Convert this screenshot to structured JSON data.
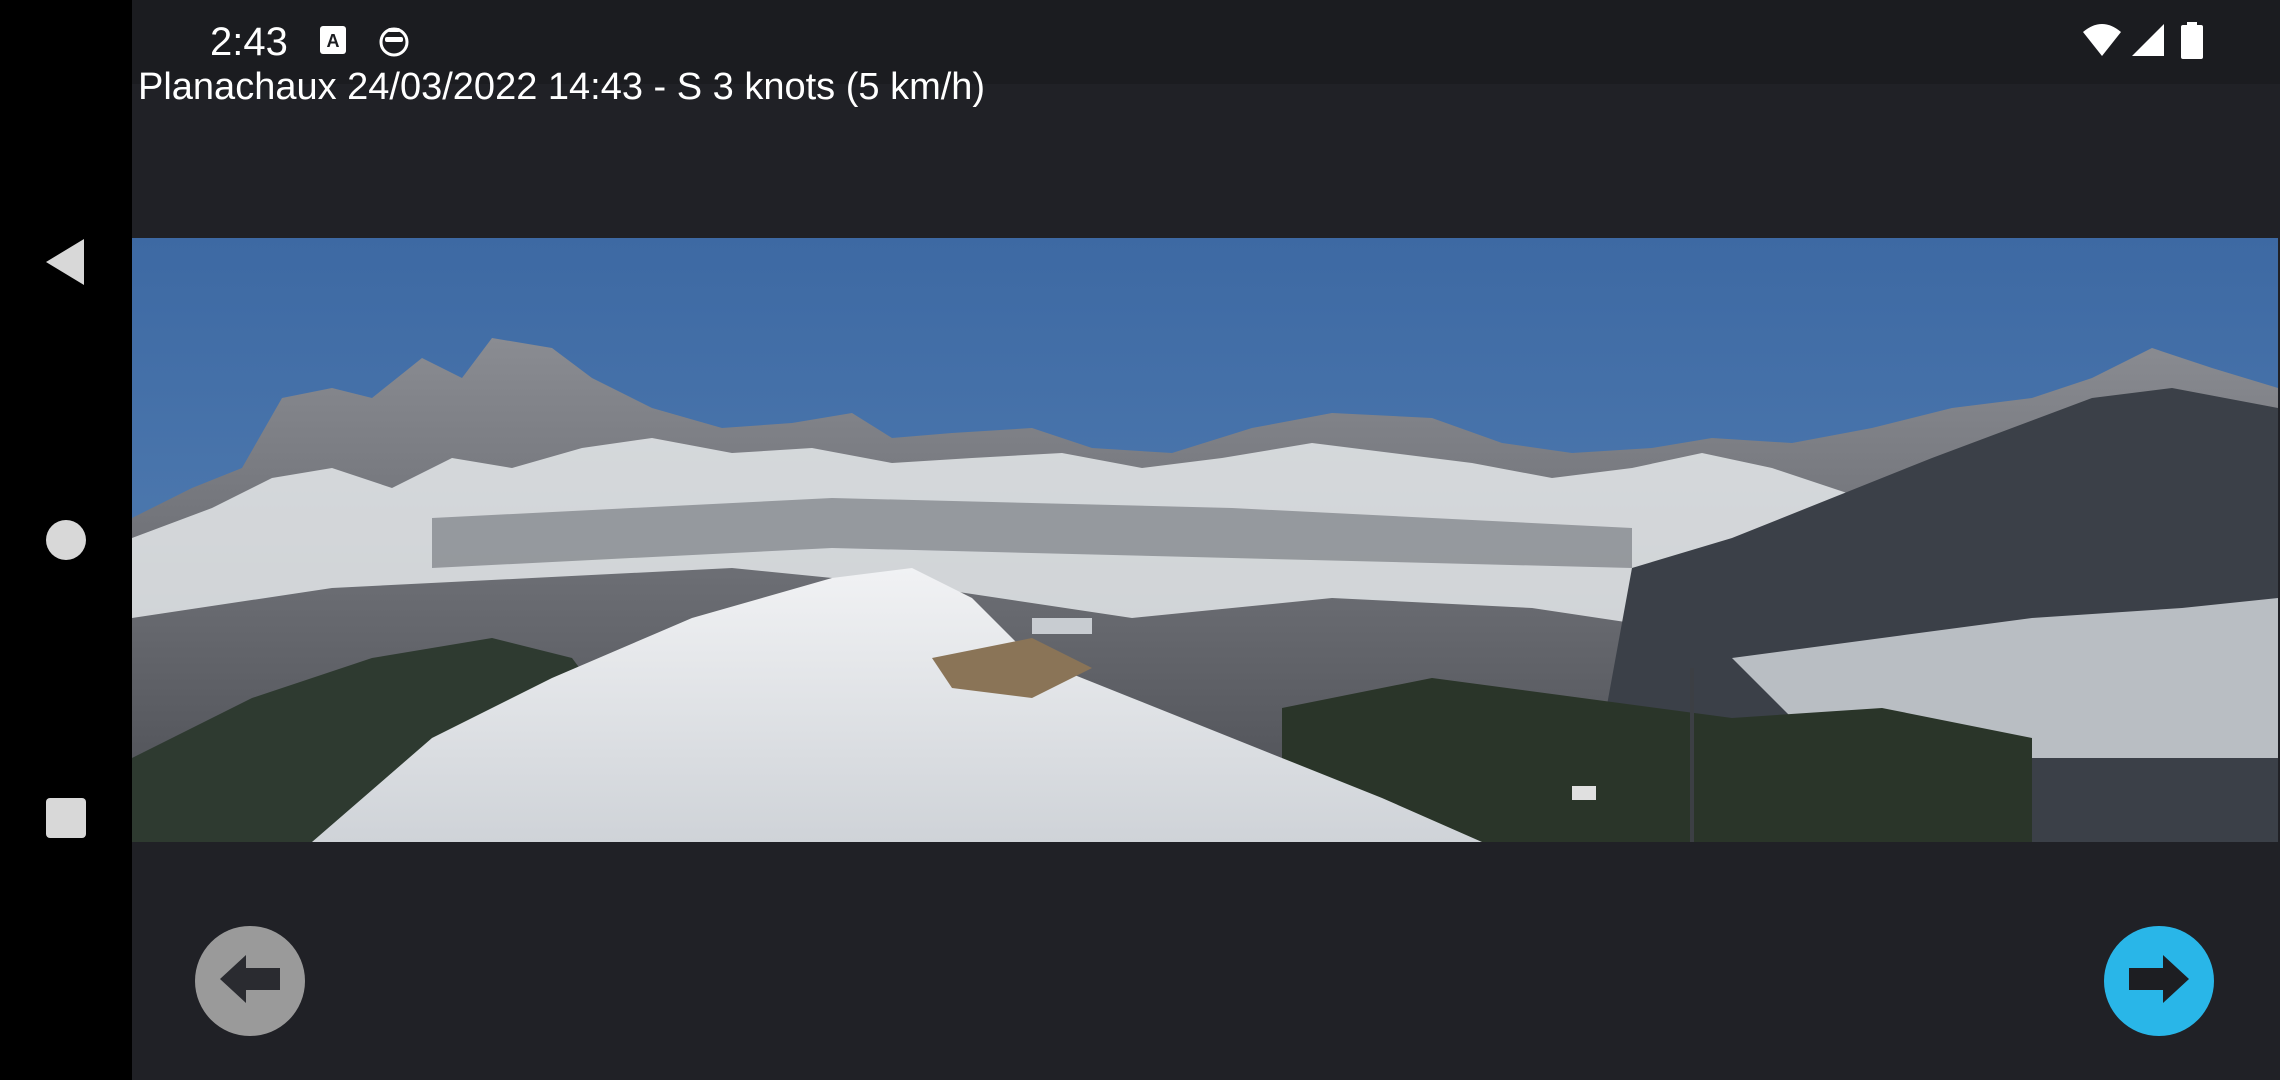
{
  "status_bar": {
    "time": "2:43",
    "icons": [
      "keyboard-a-icon",
      "accessibility-face-icon",
      "wifi-icon",
      "cell-signal-icon",
      "battery-icon"
    ]
  },
  "nav_bar": {
    "icons": [
      "back-triangle-icon",
      "home-circle-icon",
      "recents-square-icon"
    ]
  },
  "caption": "Planachaux 24/03/2022 14:43  -  S 3 knots (5 km/h)",
  "buttons": {
    "previous_icon": "arrow-left-icon",
    "next_icon": "arrow-right-icon"
  },
  "colors": {
    "background": "#202126",
    "status_bar": "#1b1c20",
    "nav_bar": "#000000",
    "prev_button": "#9a9a9a",
    "next_button": "#29b6e8",
    "sky": "#3f6ea8"
  }
}
